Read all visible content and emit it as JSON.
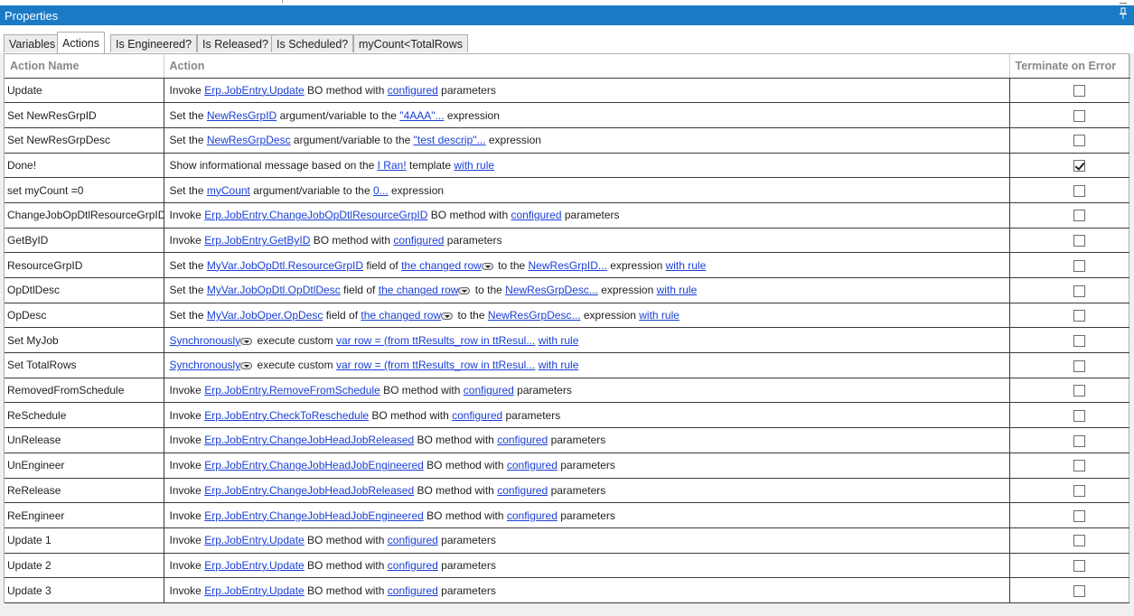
{
  "panel": {
    "title": "Properties"
  },
  "tabs": [
    {
      "label": "Variables"
    },
    {
      "label": "Actions"
    },
    {
      "label": "Is Engineered?"
    },
    {
      "label": "Is Released?"
    },
    {
      "label": "Is Scheduled?"
    },
    {
      "label": "myCount<TotalRows"
    }
  ],
  "active_tab": "Actions",
  "columns": {
    "name": "Action Name",
    "action": "Action",
    "terminate": "Terminate on Error"
  },
  "icons": {
    "pin": "pin-icon",
    "dropdown": "chevron-down-icon",
    "check": "checkmark-icon"
  },
  "colors": {
    "titlebar": "#1a7bc4",
    "link": "#1a3fd6",
    "grid_line": "#3a3a3a"
  },
  "rows": [
    {
      "name": "Update",
      "terminate": false,
      "parts": [
        {
          "t": "text",
          "v": "Invoke "
        },
        {
          "t": "link",
          "v": "Erp.JobEntry.Update"
        },
        {
          "t": "text",
          "v": " BO method with "
        },
        {
          "t": "link",
          "v": "configured"
        },
        {
          "t": "text",
          "v": " parameters"
        }
      ]
    },
    {
      "name": "Set NewResGrpID",
      "terminate": false,
      "parts": [
        {
          "t": "text",
          "v": "Set the "
        },
        {
          "t": "link",
          "v": "NewResGrpID"
        },
        {
          "t": "text",
          "v": " argument/variable to the "
        },
        {
          "t": "link",
          "v": "\"4AAA\"..."
        },
        {
          "t": "text",
          "v": " expression"
        }
      ]
    },
    {
      "name": "Set NewResGrpDesc",
      "terminate": false,
      "parts": [
        {
          "t": "text",
          "v": "Set the "
        },
        {
          "t": "link",
          "v": "NewResGrpDesc"
        },
        {
          "t": "text",
          "v": " argument/variable to the "
        },
        {
          "t": "link",
          "v": "\"test descrip\"..."
        },
        {
          "t": "text",
          "v": " expression"
        }
      ]
    },
    {
      "name": "Done!",
      "terminate": true,
      "parts": [
        {
          "t": "text",
          "v": "Show informational message based on the "
        },
        {
          "t": "link",
          "v": "I Ran!"
        },
        {
          "t": "text",
          "v": " template "
        },
        {
          "t": "link",
          "v": "with rule"
        }
      ]
    },
    {
      "name": "set myCount =0",
      "terminate": false,
      "parts": [
        {
          "t": "text",
          "v": "Set the "
        },
        {
          "t": "link",
          "v": "myCount"
        },
        {
          "t": "text",
          "v": " argument/variable to the "
        },
        {
          "t": "link",
          "v": "0..."
        },
        {
          "t": "text",
          "v": " expression"
        }
      ]
    },
    {
      "name": "ChangeJobOpDtlResourceGrpID",
      "terminate": false,
      "parts": [
        {
          "t": "text",
          "v": "Invoke "
        },
        {
          "t": "link",
          "v": "Erp.JobEntry.ChangeJobOpDtlResourceGrpID"
        },
        {
          "t": "text",
          "v": " BO method with "
        },
        {
          "t": "link",
          "v": "configured"
        },
        {
          "t": "text",
          "v": " parameters"
        }
      ]
    },
    {
      "name": "GetByID",
      "terminate": false,
      "parts": [
        {
          "t": "text",
          "v": "Invoke "
        },
        {
          "t": "link",
          "v": "Erp.JobEntry.GetByID"
        },
        {
          "t": "text",
          "v": " BO method with "
        },
        {
          "t": "link",
          "v": "configured"
        },
        {
          "t": "text",
          "v": " parameters"
        }
      ]
    },
    {
      "name": "ResourceGrpID",
      "terminate": false,
      "parts": [
        {
          "t": "text",
          "v": "Set the "
        },
        {
          "t": "link",
          "v": "MyVar.JobOpDtl.ResourceGrpID"
        },
        {
          "t": "text",
          "v": " field of "
        },
        {
          "t": "link",
          "v": "the changed row"
        },
        {
          "t": "dd"
        },
        {
          "t": "text",
          "v": " to the "
        },
        {
          "t": "link",
          "v": "NewResGrpID..."
        },
        {
          "t": "text",
          "v": " expression "
        },
        {
          "t": "link",
          "v": "with rule"
        }
      ]
    },
    {
      "name": "OpDtlDesc",
      "terminate": false,
      "parts": [
        {
          "t": "text",
          "v": "Set the "
        },
        {
          "t": "link",
          "v": "MyVar.JobOpDtl.OpDtlDesc"
        },
        {
          "t": "text",
          "v": " field of "
        },
        {
          "t": "link",
          "v": "the changed row"
        },
        {
          "t": "dd"
        },
        {
          "t": "text",
          "v": " to the "
        },
        {
          "t": "link",
          "v": "NewResGrpDesc..."
        },
        {
          "t": "text",
          "v": " expression "
        },
        {
          "t": "link",
          "v": "with rule"
        }
      ]
    },
    {
      "name": "OpDesc",
      "terminate": false,
      "parts": [
        {
          "t": "text",
          "v": "Set the "
        },
        {
          "t": "link",
          "v": "MyVar.JobOper.OpDesc"
        },
        {
          "t": "text",
          "v": " field of "
        },
        {
          "t": "link",
          "v": "the changed row"
        },
        {
          "t": "dd"
        },
        {
          "t": "text",
          "v": " to the "
        },
        {
          "t": "link",
          "v": "NewResGrpDesc..."
        },
        {
          "t": "text",
          "v": " expression "
        },
        {
          "t": "link",
          "v": "with rule"
        }
      ]
    },
    {
      "name": "Set MyJob",
      "terminate": false,
      "parts": [
        {
          "t": "link",
          "v": "Synchronously"
        },
        {
          "t": "dd"
        },
        {
          "t": "text",
          "v": " execute custom "
        },
        {
          "t": "link",
          "v": "var row = (from ttResults_row in ttResul..."
        },
        {
          "t": "text",
          "v": " "
        },
        {
          "t": "link",
          "v": "with rule"
        }
      ]
    },
    {
      "name": "Set TotalRows",
      "terminate": false,
      "parts": [
        {
          "t": "link",
          "v": "Synchronously"
        },
        {
          "t": "dd"
        },
        {
          "t": "text",
          "v": " execute custom "
        },
        {
          "t": "link",
          "v": "var row = (from ttResults_row in ttResul..."
        },
        {
          "t": "text",
          "v": " "
        },
        {
          "t": "link",
          "v": "with rule"
        }
      ]
    },
    {
      "name": "RemovedFromSchedule",
      "terminate": false,
      "parts": [
        {
          "t": "text",
          "v": "Invoke "
        },
        {
          "t": "link",
          "v": "Erp.JobEntry.RemoveFromSchedule"
        },
        {
          "t": "text",
          "v": " BO method with "
        },
        {
          "t": "link",
          "v": "configured"
        },
        {
          "t": "text",
          "v": " parameters"
        }
      ]
    },
    {
      "name": "ReSchedule",
      "terminate": false,
      "parts": [
        {
          "t": "text",
          "v": "Invoke "
        },
        {
          "t": "link",
          "v": "Erp.JobEntry.CheckToReschedule"
        },
        {
          "t": "text",
          "v": " BO method with "
        },
        {
          "t": "link",
          "v": "configured"
        },
        {
          "t": "text",
          "v": " parameters"
        }
      ]
    },
    {
      "name": "UnRelease",
      "terminate": false,
      "parts": [
        {
          "t": "text",
          "v": "Invoke "
        },
        {
          "t": "link",
          "v": "Erp.JobEntry.ChangeJobHeadJobReleased"
        },
        {
          "t": "text",
          "v": " BO method with "
        },
        {
          "t": "link",
          "v": "configured"
        },
        {
          "t": "text",
          "v": " parameters"
        }
      ]
    },
    {
      "name": "UnEngineer",
      "terminate": false,
      "parts": [
        {
          "t": "text",
          "v": "Invoke "
        },
        {
          "t": "link",
          "v": "Erp.JobEntry.ChangeJobHeadJobEngineered"
        },
        {
          "t": "text",
          "v": " BO method with "
        },
        {
          "t": "link",
          "v": "configured"
        },
        {
          "t": "text",
          "v": " parameters"
        }
      ]
    },
    {
      "name": "ReRelease",
      "terminate": false,
      "parts": [
        {
          "t": "text",
          "v": "Invoke "
        },
        {
          "t": "link",
          "v": "Erp.JobEntry.ChangeJobHeadJobReleased"
        },
        {
          "t": "text",
          "v": " BO method with "
        },
        {
          "t": "link",
          "v": "configured"
        },
        {
          "t": "text",
          "v": " parameters"
        }
      ]
    },
    {
      "name": "ReEngineer",
      "terminate": false,
      "parts": [
        {
          "t": "text",
          "v": "Invoke "
        },
        {
          "t": "link",
          "v": "Erp.JobEntry.ChangeJobHeadJobEngineered"
        },
        {
          "t": "text",
          "v": " BO method with "
        },
        {
          "t": "link",
          "v": "configured"
        },
        {
          "t": "text",
          "v": " parameters"
        }
      ]
    },
    {
      "name": "Update 1",
      "terminate": false,
      "parts": [
        {
          "t": "text",
          "v": "Invoke "
        },
        {
          "t": "link",
          "v": "Erp.JobEntry.Update"
        },
        {
          "t": "text",
          "v": " BO method with "
        },
        {
          "t": "link",
          "v": "configured"
        },
        {
          "t": "text",
          "v": " parameters"
        }
      ]
    },
    {
      "name": "Update 2",
      "terminate": false,
      "parts": [
        {
          "t": "text",
          "v": "Invoke "
        },
        {
          "t": "link",
          "v": "Erp.JobEntry.Update"
        },
        {
          "t": "text",
          "v": " BO method with "
        },
        {
          "t": "link",
          "v": "configured"
        },
        {
          "t": "text",
          "v": " parameters"
        }
      ]
    },
    {
      "name": "Update 3",
      "terminate": false,
      "parts": [
        {
          "t": "text",
          "v": "Invoke "
        },
        {
          "t": "link",
          "v": "Erp.JobEntry.Update"
        },
        {
          "t": "text",
          "v": " BO method with "
        },
        {
          "t": "link",
          "v": "configured"
        },
        {
          "t": "text",
          "v": " parameters"
        }
      ]
    }
  ]
}
